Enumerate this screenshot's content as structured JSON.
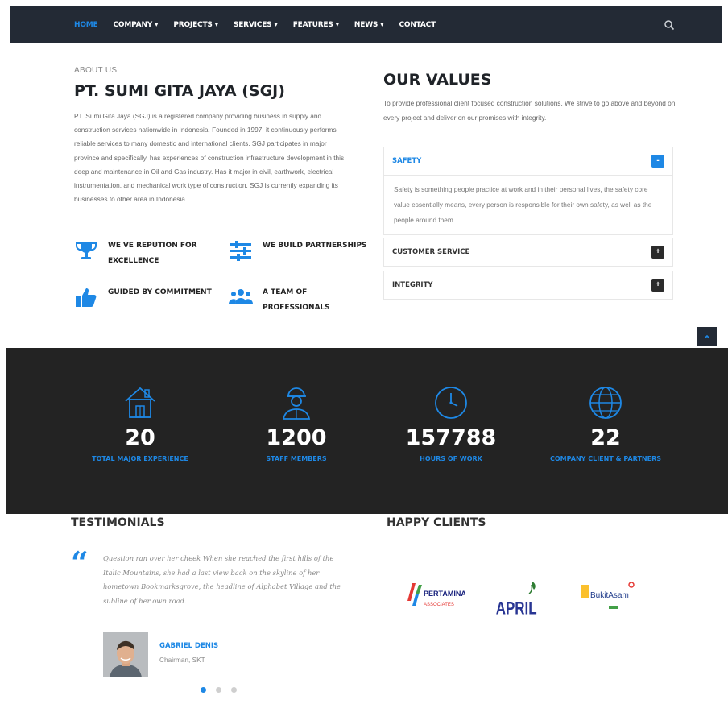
{
  "nav": {
    "items": [
      {
        "label": "HOME",
        "active": true
      },
      {
        "label": "COMPANY ▾",
        "active": false
      },
      {
        "label": "PROJECTS ▾",
        "active": false
      },
      {
        "label": "SERVICES ▾",
        "active": false
      },
      {
        "label": "FEATURES ▾",
        "active": false
      },
      {
        "label": "NEWS ▾",
        "active": false
      },
      {
        "label": "CONTACT",
        "active": false
      }
    ],
    "search_icon": "search-icon"
  },
  "about": {
    "eyebrow": "ABOUT US",
    "title": "PT. SUMI GITA JAYA (SGJ)",
    "text": "PT. Sumi Gita Jaya (SGJ) is a registered company providing business in supply and construction services nationwide in Indonesia. Founded in 1997, it continuously performs reliable services to many domestic and international clients. SGJ participates in major province and specifically, has experiences of construction infrastructure development in this deep and maintenance in Oil and Gas industry. Has it major in civil, earthwork, electrical instrumentation, and mechanical work type of construction. SGJ is currently expanding its businesses to other area in Indonesia.",
    "features": [
      {
        "label": "WE'VE REPUTION FOR EXCELLENCE",
        "icon": "trophy-icon"
      },
      {
        "label": "WE BUILD PARTNERSHIPS",
        "icon": "sliders-icon"
      },
      {
        "label": "GUIDED BY COMMITMENT",
        "icon": "thumbs-up-icon"
      },
      {
        "label": "A TEAM OF PROFESSIONALS",
        "icon": "team-icon"
      }
    ]
  },
  "values": {
    "title": "OUR VALUES",
    "text": "To provide professional client focused construction solutions. We strive to go above and beyond on every project and deliver on our promises with integrity.",
    "accordion": [
      {
        "title": "SAFETY",
        "open": true,
        "toggle": "-",
        "body": "Safety is something people practice at work and in their personal lives, the safety core value essentially means, every person is responsible for their own safety, as well as the people around them."
      },
      {
        "title": "CUSTOMER SERVICE",
        "open": false,
        "toggle": "+"
      },
      {
        "title": "INTEGRITY",
        "open": false,
        "toggle": "+"
      }
    ]
  },
  "stats": [
    {
      "value": "20",
      "label": "TOTAL MAJOR EXPERIENCE",
      "icon": "building-icon"
    },
    {
      "value": "1200",
      "label": "STAFF MEMBERS",
      "icon": "worker-icon"
    },
    {
      "value": "157788",
      "label": "HOURS OF WORK",
      "icon": "clock-icon"
    },
    {
      "value": "22",
      "label": "COMPANY CLIENT & PARTNERS",
      "icon": "globe-icon"
    }
  ],
  "testimonials": {
    "title": "TESTIMONIALS",
    "quote": "Question ran over her cheek When she reached the first hills of the Italic Mountains, she had a last view back on the skyline of her hometown Bookmarksgrove, the headline of Alphabet Village and the subline of her own road.",
    "name": "GABRIEL DENIS",
    "role": "Chairman, SKT",
    "slides": 3,
    "active_slide": 0
  },
  "clients": {
    "title": "HAPPY CLIENTS",
    "logos": [
      {
        "name": "PERTAMINA",
        "sub": "ASSOCIATES"
      },
      {
        "name": "APRIL"
      },
      {
        "name": "BukitAsam"
      }
    ]
  },
  "colors": {
    "accent": "#1e88e5",
    "nav_bg": "#232a35",
    "stats_bg": "#232323"
  }
}
